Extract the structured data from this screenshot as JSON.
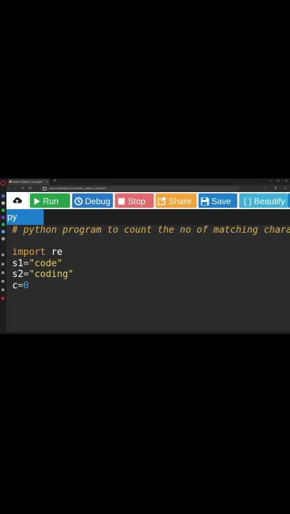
{
  "browser": {
    "tab_title": "Online Python Compiler",
    "tab_close": "×",
    "newtab": "+",
    "window_controls": [
      "–",
      "□",
      "×"
    ],
    "nav": [
      "‹",
      "›",
      "⟳",
      "⊞"
    ],
    "url": "www.onlinegdb.com/online_python_compiler",
    "addr_right": [
      "♡",
      "⬇",
      "≡"
    ]
  },
  "toolbar": {
    "run": "Run",
    "debug": "Debug",
    "stop": "Stop",
    "share": "Share",
    "save": "Save",
    "beautify": "{ } Beautify",
    "colors": {
      "run": "#2aa748",
      "debug": "#2878c8",
      "stop": "#e3686e",
      "share": "#f2a43a",
      "save": "#1f7fc9",
      "beautify": "#3eb3d6"
    }
  },
  "file_tab": {
    "name": "py"
  },
  "editor": {
    "comment": "# python program to count the no of matching characters",
    "line2_kw": "import",
    "line2_id": " re",
    "line3_id": "s1",
    "line3_op": "=",
    "line3_str": "\"code\"",
    "line4_id": "s2",
    "line4_op": "=",
    "line4_str": "\"coding\"",
    "line5_id": "c",
    "line5_op": "=",
    "line5_num": "0"
  }
}
